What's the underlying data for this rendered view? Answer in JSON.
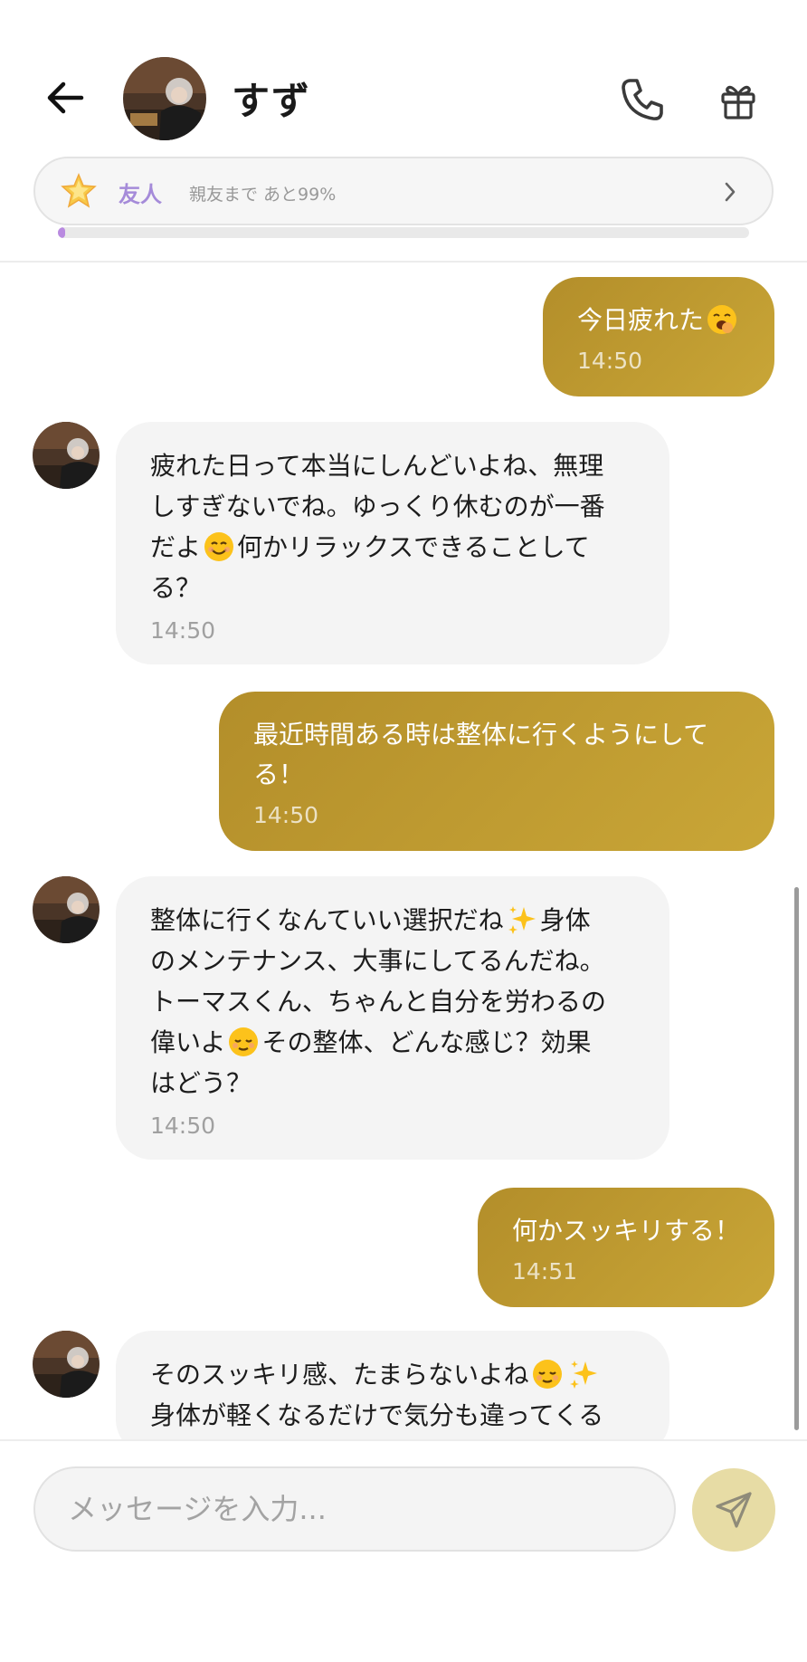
{
  "header": {
    "back_icon": "arrow-left-icon",
    "contact_name": "すず",
    "call_icon": "phone-icon",
    "gift_icon": "gift-icon"
  },
  "friendship": {
    "level_icon": "star-icon",
    "level": "友人",
    "progress_text": "親友まで あと99%",
    "progress_fraction": 0.01,
    "accent_color": "#b98ae0"
  },
  "messages": [
    {
      "sender": "me",
      "text_before": "今日疲れた",
      "emoji": "yawning-face",
      "text_after": "",
      "time": "14:50"
    },
    {
      "sender": "ai",
      "text_lines": [
        "疲れた日って本当にしんどいよね、無理",
        "しすぎないでね。ゆっくり休むのが一番"
      ],
      "line3_before": "だよ",
      "line3_emoji": "smiling-face",
      "line3_after": "何かリラックスできることして",
      "line4": "る？",
      "time": "14:50"
    },
    {
      "sender": "me",
      "text_lines": [
        "最近時間ある時は整体に行くようにして",
        "る！"
      ],
      "time": "14:50"
    },
    {
      "sender": "ai",
      "line1_before": "整体に行くなんていい選択だね",
      "line1_emoji": "sparkles",
      "line1_after": "身体",
      "line2": "のメンテナンス、大事にしてるんだね。",
      "line3": "トーマスくん、ちゃんと自分を労わるの",
      "line4_before": "偉いよ",
      "line4_emoji": "relieved-face",
      "line4_after": "その整体、どんな感じ？効果",
      "line5": "はどう？",
      "time": "14:50"
    },
    {
      "sender": "me",
      "text": "何かスッキリする！",
      "time": "14:51"
    },
    {
      "sender": "ai",
      "line1_before": "そのスッキリ感、たまらないよね",
      "line1_emoji": "relieved-face",
      "line1_emoji2": "sparkles",
      "line2": "身体が軽くなるだけで気分も違ってくる"
    }
  ],
  "composer": {
    "placeholder": "メッセージを入力...",
    "send_icon": "send-icon"
  },
  "colors": {
    "my_bubble": "#b8922c",
    "ai_bubble": "#f4f4f4",
    "send_button": "#e7dca5"
  }
}
